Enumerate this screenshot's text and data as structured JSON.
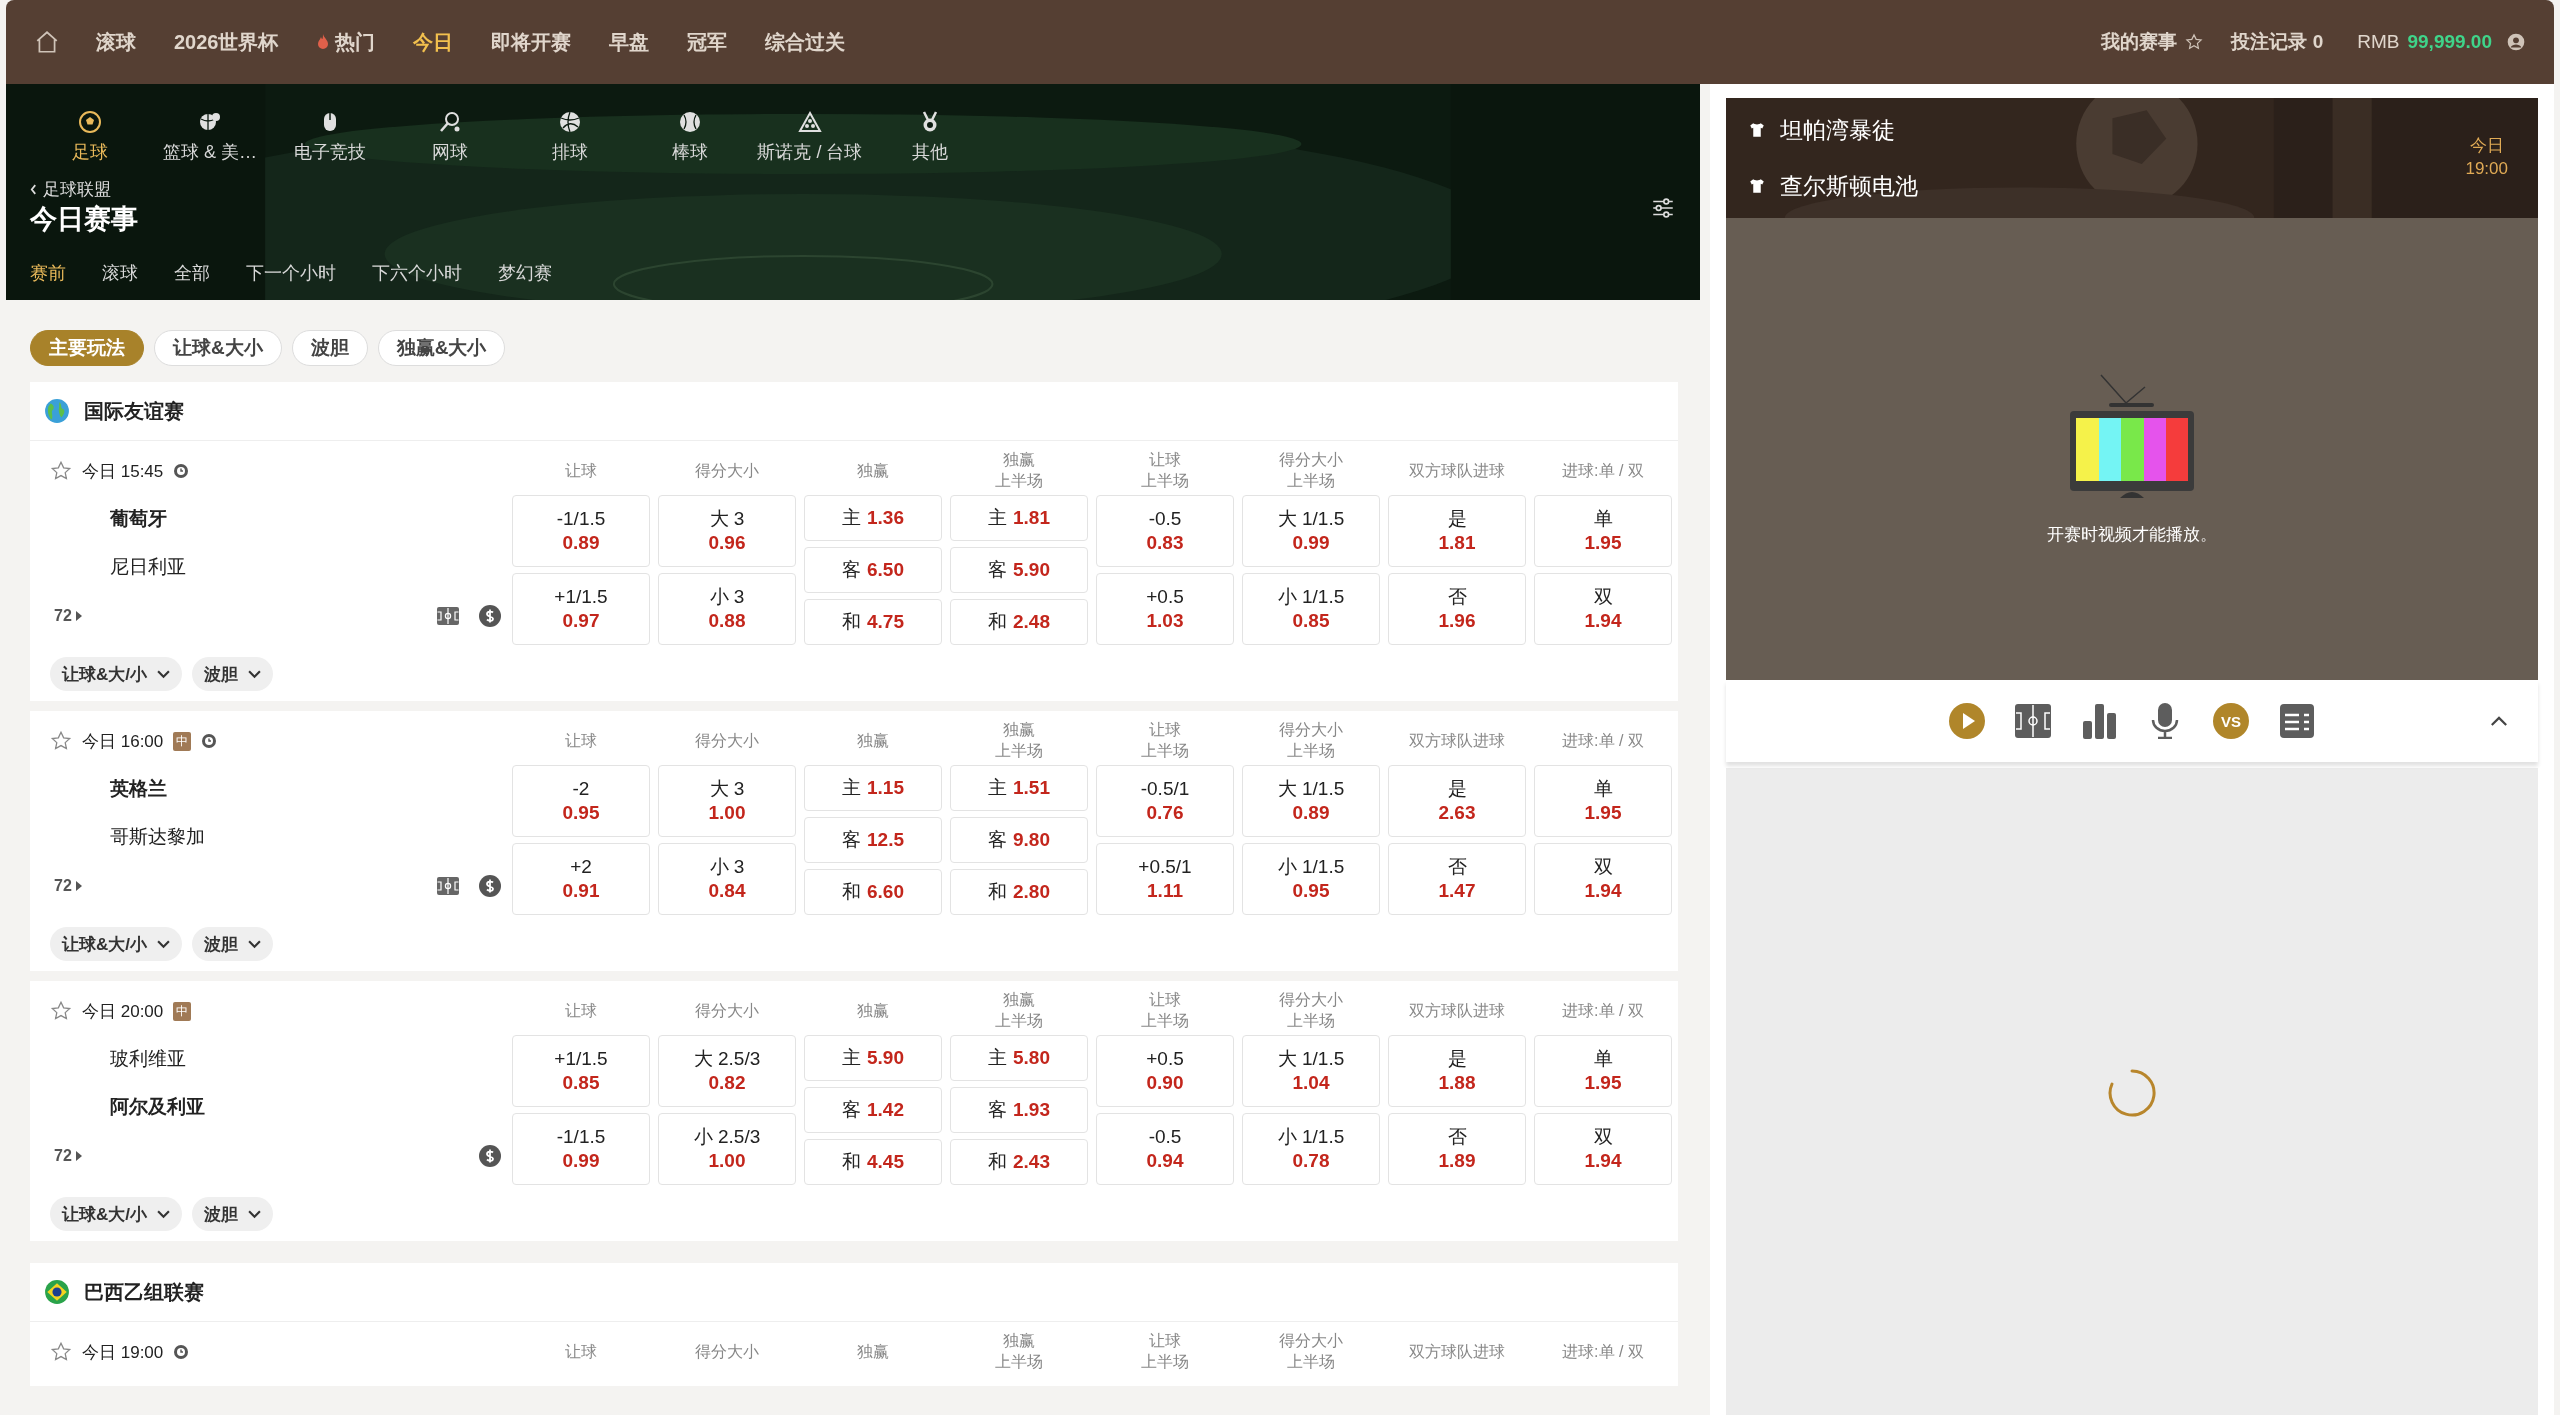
{
  "top_nav": {
    "items": [
      {
        "label": "滚球",
        "kind": "plain",
        "selected": false
      },
      {
        "label": "2026世界杯",
        "kind": "plain",
        "selected": false
      },
      {
        "label": "热门",
        "kind": "hot",
        "selected": false
      },
      {
        "label": "今日",
        "kind": "plain",
        "selected": true
      },
      {
        "label": "即将开赛",
        "kind": "plain",
        "selected": false
      },
      {
        "label": "早盘",
        "kind": "plain",
        "selected": false
      },
      {
        "label": "冠军",
        "kind": "plain",
        "selected": false
      },
      {
        "label": "综合过关",
        "kind": "plain",
        "selected": false
      }
    ],
    "my_events": "我的赛事",
    "bet_records": "投注记录 0",
    "currency": "RMB",
    "balance": "99,999.00"
  },
  "sports": [
    {
      "label": "足球",
      "kind": "soccer",
      "selected": true
    },
    {
      "label": "篮球 & 美…",
      "kind": "basketball",
      "selected": false
    },
    {
      "label": "电子竞技",
      "kind": "esports",
      "selected": false
    },
    {
      "label": "网球",
      "kind": "tennis",
      "selected": false
    },
    {
      "label": "排球",
      "kind": "volleyball",
      "selected": false
    },
    {
      "label": "棒球",
      "kind": "baseball",
      "selected": false
    },
    {
      "label": "斯诺克 / 台球",
      "kind": "snooker",
      "selected": false
    },
    {
      "label": "其他",
      "kind": "other",
      "selected": false
    }
  ],
  "breadcrumb": "足球联盟",
  "page_title": "今日赛事",
  "time_filters": [
    {
      "label": "赛前",
      "selected": true
    },
    {
      "label": "滚球",
      "selected": false
    },
    {
      "label": "全部",
      "selected": false
    },
    {
      "label": "下一个小时",
      "selected": false
    },
    {
      "label": "下六个小时",
      "selected": false
    },
    {
      "label": "梦幻赛",
      "selected": false
    }
  ],
  "market_tabs": [
    {
      "label": "主要玩法",
      "selected": true
    },
    {
      "label": "让球&大小",
      "selected": false
    },
    {
      "label": "波胆",
      "selected": false
    },
    {
      "label": "独赢&大小",
      "selected": false
    }
  ],
  "leagues": [
    {
      "name": "国际友谊赛",
      "kind": "globe",
      "matches": [
        {
          "time": "今日 15:45",
          "clock": true,
          "count": "72",
          "field_view": true,
          "teams": [
            {
              "name": "葡萄牙",
              "highlighted": true
            },
            {
              "name": "尼日利亚",
              "highlighted": false
            }
          ],
          "markets": [
            {
              "header": [
                "让球"
              ],
              "cells": [
                {
                  "label": "-1/1.5",
                  "odds": "0.89"
                },
                {
                  "label": "+1/1.5",
                  "odds": "0.97"
                }
              ]
            },
            {
              "header": [
                "得分大小"
              ],
              "cells": [
                {
                  "label": "大 3",
                  "odds": "0.96"
                },
                {
                  "label": "小 3",
                  "odds": "0.88"
                }
              ]
            },
            {
              "header": [
                "独赢"
              ],
              "cells": [
                {
                  "label": "主",
                  "odds": "1.36"
                },
                {
                  "label": "客",
                  "odds": "6.50"
                },
                {
                  "label": "和",
                  "odds": "4.75"
                }
              ]
            },
            {
              "header": [
                "独赢",
                "上半场"
              ],
              "cells": [
                {
                  "label": "主",
                  "odds": "1.81"
                },
                {
                  "label": "客",
                  "odds": "5.90"
                },
                {
                  "label": "和",
                  "odds": "2.48"
                }
              ]
            },
            {
              "header": [
                "让球",
                "上半场"
              ],
              "cells": [
                {
                  "label": "-0.5",
                  "odds": "0.83"
                },
                {
                  "label": "+0.5",
                  "odds": "1.03"
                }
              ]
            },
            {
              "header": [
                "得分大小",
                "上半场"
              ],
              "cells": [
                {
                  "label": "大 1/1.5",
                  "odds": "0.99"
                },
                {
                  "label": "小 1/1.5",
                  "odds": "0.85"
                }
              ]
            },
            {
              "header": [
                "双方球队进球"
              ],
              "cells": [
                {
                  "label": "是",
                  "odds": "1.81"
                },
                {
                  "label": "否",
                  "odds": "1.96"
                }
              ]
            },
            {
              "header": [
                "进球:单 / 双"
              ],
              "cells": [
                {
                  "label": "单",
                  "odds": "1.95"
                },
                {
                  "label": "双",
                  "odds": "1.94"
                }
              ]
            }
          ],
          "dropdowns": [
            "让球&大/小",
            "波胆"
          ]
        },
        {
          "time": "今日 16:00",
          "badge": "中",
          "clock": true,
          "count": "72",
          "field_view": true,
          "teams": [
            {
              "name": "英格兰",
              "highlighted": true
            },
            {
              "name": "哥斯达黎加",
              "highlighted": false
            }
          ],
          "markets": [
            {
              "header": [
                "让球"
              ],
              "cells": [
                {
                  "label": "-2",
                  "odds": "0.95"
                },
                {
                  "label": "+2",
                  "odds": "0.91"
                }
              ]
            },
            {
              "header": [
                "得分大小"
              ],
              "cells": [
                {
                  "label": "大 3",
                  "odds": "1.00"
                },
                {
                  "label": "小 3",
                  "odds": "0.84"
                }
              ]
            },
            {
              "header": [
                "独赢"
              ],
              "cells": [
                {
                  "label": "主",
                  "odds": "1.15"
                },
                {
                  "label": "客",
                  "odds": "12.5"
                },
                {
                  "label": "和",
                  "odds": "6.60"
                }
              ]
            },
            {
              "header": [
                "独赢",
                "上半场"
              ],
              "cells": [
                {
                  "label": "主",
                  "odds": "1.51"
                },
                {
                  "label": "客",
                  "odds": "9.80"
                },
                {
                  "label": "和",
                  "odds": "2.80"
                }
              ]
            },
            {
              "header": [
                "让球",
                "上半场"
              ],
              "cells": [
                {
                  "label": "-0.5/1",
                  "odds": "0.76"
                },
                {
                  "label": "+0.5/1",
                  "odds": "1.11"
                }
              ]
            },
            {
              "header": [
                "得分大小",
                "上半场"
              ],
              "cells": [
                {
                  "label": "大 1/1.5",
                  "odds": "0.89"
                },
                {
                  "label": "小 1/1.5",
                  "odds": "0.95"
                }
              ]
            },
            {
              "header": [
                "双方球队进球"
              ],
              "cells": [
                {
                  "label": "是",
                  "odds": "2.63"
                },
                {
                  "label": "否",
                  "odds": "1.47"
                }
              ]
            },
            {
              "header": [
                "进球:单 / 双"
              ],
              "cells": [
                {
                  "label": "单",
                  "odds": "1.95"
                },
                {
                  "label": "双",
                  "odds": "1.94"
                }
              ]
            }
          ],
          "dropdowns": [
            "让球&大/小",
            "波胆"
          ]
        },
        {
          "time": "今日 20:00",
          "badge": "中",
          "clock": false,
          "count": "72",
          "field_view": false,
          "teams": [
            {
              "name": "玻利维亚",
              "highlighted": false
            },
            {
              "name": "阿尔及利亚",
              "highlighted": true
            }
          ],
          "markets": [
            {
              "header": [
                "让球"
              ],
              "cells": [
                {
                  "label": "+1/1.5",
                  "odds": "0.85"
                },
                {
                  "label": "-1/1.5",
                  "odds": "0.99"
                }
              ]
            },
            {
              "header": [
                "得分大小"
              ],
              "cells": [
                {
                  "label": "大 2.5/3",
                  "odds": "0.82"
                },
                {
                  "label": "小 2.5/3",
                  "odds": "1.00"
                }
              ]
            },
            {
              "header": [
                "独赢"
              ],
              "cells": [
                {
                  "label": "主",
                  "odds": "5.90"
                },
                {
                  "label": "客",
                  "odds": "1.42"
                },
                {
                  "label": "和",
                  "odds": "4.45"
                }
              ]
            },
            {
              "header": [
                "独赢",
                "上半场"
              ],
              "cells": [
                {
                  "label": "主",
                  "odds": "5.80"
                },
                {
                  "label": "客",
                  "odds": "1.93"
                },
                {
                  "label": "和",
                  "odds": "2.43"
                }
              ]
            },
            {
              "header": [
                "让球",
                "上半场"
              ],
              "cells": [
                {
                  "label": "+0.5",
                  "odds": "0.90"
                },
                {
                  "label": "-0.5",
                  "odds": "0.94"
                }
              ]
            },
            {
              "header": [
                "得分大小",
                "上半场"
              ],
              "cells": [
                {
                  "label": "大 1/1.5",
                  "odds": "1.04"
                },
                {
                  "label": "小 1/1.5",
                  "odds": "0.78"
                }
              ]
            },
            {
              "header": [
                "双方球队进球"
              ],
              "cells": [
                {
                  "label": "是",
                  "odds": "1.88"
                },
                {
                  "label": "否",
                  "odds": "1.89"
                }
              ]
            },
            {
              "header": [
                "进球:单 / 双"
              ],
              "cells": [
                {
                  "label": "单",
                  "odds": "1.95"
                },
                {
                  "label": "双",
                  "odds": "1.94"
                }
              ]
            }
          ],
          "dropdowns": [
            "让球&大/小",
            "波胆"
          ]
        }
      ]
    },
    {
      "name": "巴西乙组联赛",
      "kind": "brazil",
      "matches": [
        {
          "time": "今日 19:00",
          "clock": true,
          "markets": [
            {
              "header": [
                "让球"
              ]
            },
            {
              "header": [
                "得分大小"
              ]
            },
            {
              "header": [
                "独赢"
              ]
            },
            {
              "header": [
                "独赢",
                "上半场"
              ]
            },
            {
              "header": [
                "让球",
                "上半场"
              ]
            },
            {
              "header": [
                "得分大小",
                "上半场"
              ]
            },
            {
              "header": [
                "双方球队进球"
              ]
            },
            {
              "header": [
                "进球:单 / 双"
              ]
            }
          ]
        }
      ]
    }
  ],
  "live_panel": {
    "teams": [
      "坦帕湾暴徒",
      "查尔斯顿电池"
    ],
    "day": "今日",
    "time": "19:00",
    "message": "开赛时视频才能播放。",
    "toolbar": [
      {
        "kind": "play",
        "highlighted": true
      },
      {
        "kind": "field",
        "highlighted": false
      },
      {
        "kind": "stats",
        "highlighted": false
      },
      {
        "kind": "mic",
        "highlighted": false
      },
      {
        "kind": "vs",
        "label": "VS",
        "highlighted": true
      },
      {
        "kind": "scoreboard",
        "highlighted": false
      }
    ]
  }
}
